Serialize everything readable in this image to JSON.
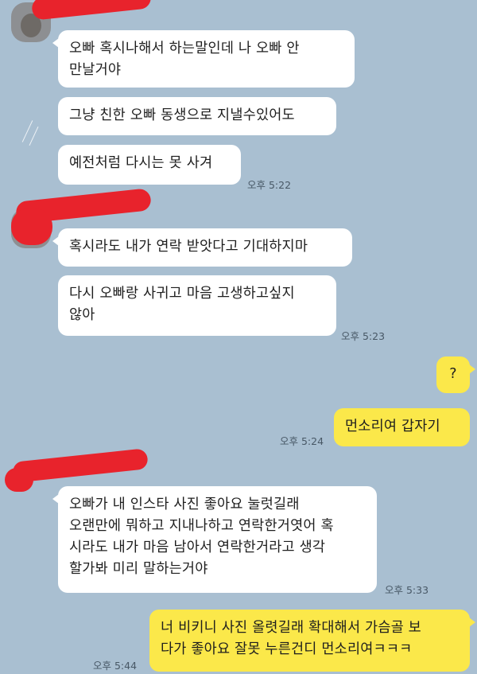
{
  "colors": {
    "background": "#a9bfd1",
    "incoming_bubble": "#ffffff",
    "outgoing_bubble": "#fbe84a",
    "redaction": "#e8232c"
  },
  "messages": [
    {
      "sender": "them",
      "text": "오빠 혹시나해서 하는말인데 나 오빠 안\n만날거야"
    },
    {
      "sender": "them",
      "text": "그냥 친한 오빠 동생으로 지낼수있어도"
    },
    {
      "sender": "them",
      "text": "예전처럼 다시는 못 사겨"
    },
    {
      "sender": "them",
      "text": "혹시라도 내가 연락 받앗다고 기대하지마"
    },
    {
      "sender": "them",
      "text": "다시 오빠랑 사귀고 마음 고생하고싶지\n않아"
    },
    {
      "sender": "me",
      "text": "?"
    },
    {
      "sender": "me",
      "text": "먼소리여 갑자기"
    },
    {
      "sender": "them",
      "text": "오빠가 내 인스타 사진 좋아요 눌럿길래\n오랜만에 뭐하고 지내나하고 연락한거엿어 혹\n시라도 내가 마음 남아서 연락한거라고 생각\n할가봐 미리 말하는거야"
    },
    {
      "sender": "me",
      "text": "너 비키니 사진 올렷길래 확대해서 가슴골 보\n다가 좋아요 잘못 누른건디 먼소리여ㅋㅋㅋ"
    }
  ],
  "timestamps": [
    "오후 5:22",
    "오후 5:23",
    "오후 5:24",
    "오후 5:33",
    "오후 5:44"
  ]
}
